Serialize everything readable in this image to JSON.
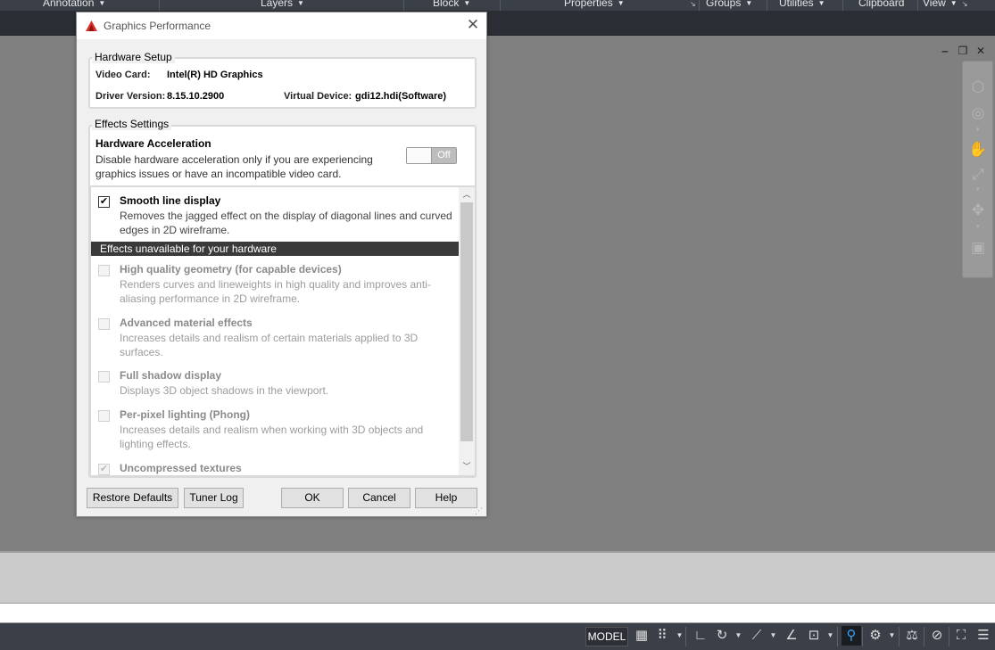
{
  "ribbon": {
    "panels": [
      {
        "label": "Annotation",
        "dropdown": "▼"
      },
      {
        "label": "Layers",
        "dropdown": "▼"
      },
      {
        "label": "Block",
        "dropdown": "▼"
      },
      {
        "label": "Properties",
        "dropdown": "▼",
        "launcher": "↘"
      },
      {
        "label": "Groups",
        "dropdown": "▼"
      },
      {
        "label": "Utilities",
        "dropdown": "▼"
      },
      {
        "label": "Clipboard"
      },
      {
        "label": "View",
        "dropdown": "▼",
        "launcher": "↘"
      }
    ]
  },
  "viewport_controls": {
    "minimize": "‒",
    "restore": "❐",
    "close": "✕"
  },
  "status_bar": {
    "model_label": "MODEL",
    "icons": [
      "grid-icon",
      "snap-icon",
      "ortho-icon",
      "polar-icon",
      "isodraft-icon",
      "object-snap-tracking-icon",
      "object-snap-icon",
      "annotation-visibility-icon",
      "workspace-gear-icon",
      "annotation-scale-icon",
      "isolate-objects-icon",
      "fullscreen-icon",
      "customize-icon"
    ]
  },
  "dialog": {
    "title": "Graphics Performance",
    "close_glyph": "✕",
    "app_icon_color": "#d9302c",
    "hardware_setup": {
      "legend": "Hardware Setup",
      "video_card_label": "Video Card:",
      "video_card_value": "Intel(R) HD Graphics",
      "driver_version_label": "Driver Version:",
      "driver_version_value": "8.15.10.2900",
      "virtual_device_label": "Virtual Device:",
      "virtual_device_value": "gdi12.hdi(Software)"
    },
    "effects_settings": {
      "legend": "Effects Settings",
      "hw_accel_title": "Hardware Acceleration",
      "hw_accel_desc": "Disable hardware acceleration only if you are experiencing graphics issues or have an incompatible video card.",
      "toggle_state": "Off",
      "smooth_line": {
        "title": "Smooth line display",
        "desc": "Removes the jagged effect on the display of diagonal lines and curved edges in 2D wireframe.",
        "checked": "✔"
      },
      "unavailable_header": "Effects unavailable for your hardware",
      "unavailable_items": [
        {
          "title": "High quality geometry (for capable devices)",
          "desc": "Renders curves and lineweights in high quality and improves anti-aliasing performance in 2D wireframe."
        },
        {
          "title": "Advanced material effects",
          "desc": "Increases details and realism of certain materials applied to 3D surfaces."
        },
        {
          "title": "Full shadow display",
          "desc": "Displays 3D object shadows in the viewport."
        },
        {
          "title": "Per-pixel lighting (Phong)",
          "desc": "Increases details and realism when working with 3D objects and lighting effects."
        },
        {
          "title": "Uncompressed textures",
          "checked": "✔"
        }
      ]
    },
    "buttons": {
      "restore_defaults": "Restore Defaults",
      "tuner_log": "Tuner Log",
      "ok": "OK",
      "cancel": "Cancel",
      "help": "Help"
    }
  }
}
